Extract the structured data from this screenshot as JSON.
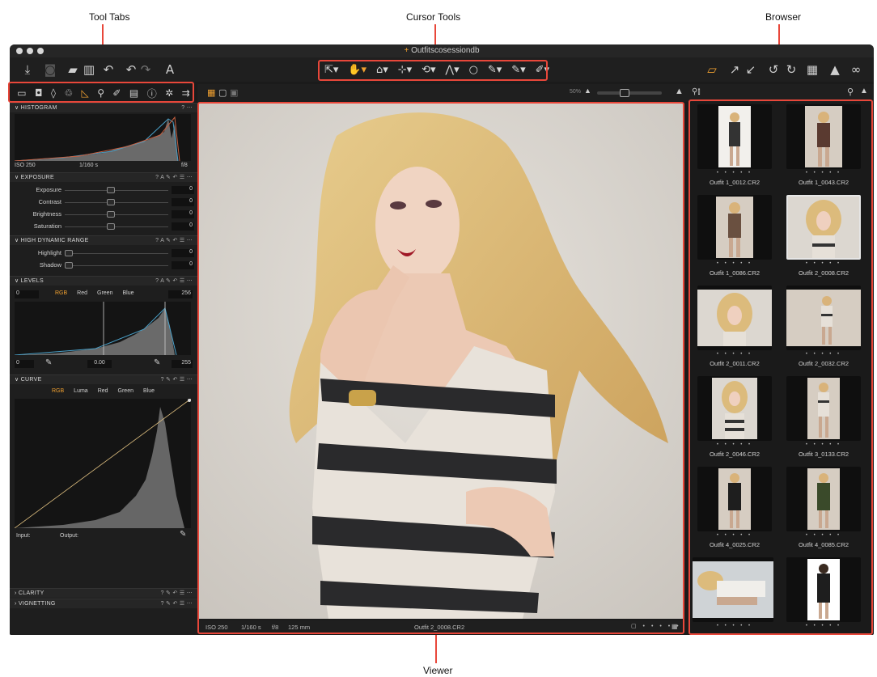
{
  "callouts": {
    "tool_tabs": "Tool Tabs",
    "cursor_tools": "Cursor Tools",
    "browser": "Browser",
    "viewer": "Viewer"
  },
  "window": {
    "title": "Outfitscosessiondb"
  },
  "cursor_tools": [
    "select-pointer-icon",
    "pan-hand-icon",
    "loupe-icon",
    "crop-icon",
    "rotate-icon",
    "keystone-icon",
    "spot-removal-icon",
    "color-picker-icon",
    "white-balance-picker-icon",
    "brush-icon"
  ],
  "left_panel": {
    "histogram": {
      "title": "HISTOGRAM",
      "iso": "ISO 250",
      "shutter": "1/160 s",
      "aperture": "f/8"
    },
    "exposure": {
      "title": "EXPOSURE",
      "rows": [
        {
          "label": "Exposure",
          "value": "0"
        },
        {
          "label": "Contrast",
          "value": "0"
        },
        {
          "label": "Brightness",
          "value": "0"
        },
        {
          "label": "Saturation",
          "value": "0"
        }
      ]
    },
    "hdr": {
      "title": "HIGH DYNAMIC RANGE",
      "rows": [
        {
          "label": "Highlight",
          "value": "0"
        },
        {
          "label": "Shadow",
          "value": "0"
        }
      ]
    },
    "levels": {
      "title": "LEVELS",
      "channels": [
        "RGB",
        "Red",
        "Green",
        "Blue"
      ],
      "left_val": "0",
      "right_val": "256",
      "bottom_left": "0",
      "bottom_mid": "0.00",
      "bottom_right": "255"
    },
    "curve": {
      "title": "CURVE",
      "channels": [
        "RGB",
        "Luma",
        "Red",
        "Green",
        "Blue"
      ],
      "input_label": "Input:",
      "output_label": "Output:"
    },
    "clarity": {
      "title": "CLARITY"
    },
    "vignetting": {
      "title": "VIGNETTING"
    }
  },
  "viewer": {
    "zoom": "50%",
    "status": {
      "iso": "ISO 250",
      "shutter": "1/160 s",
      "aperture": "f/8",
      "focal": "125 mm",
      "filename": "Outfit 2_0008.CR2"
    }
  },
  "browser": {
    "thumbs": [
      {
        "name": "Outfit 1_0012.CR2"
      },
      {
        "name": "Outfit 1_0043.CR2"
      },
      {
        "name": "Outfit 1_0086.CR2"
      },
      {
        "name": "Outfit 2_0008.CR2"
      },
      {
        "name": "Outfit 2_0011.CR2"
      },
      {
        "name": "Outfit 2_0032.CR2"
      },
      {
        "name": "Outfit 2_0046.CR2"
      },
      {
        "name": "Outfit 3_0133.CR2"
      },
      {
        "name": "Outfit 4_0025.CR2"
      },
      {
        "name": "Outfit 4_0085.CR2"
      },
      {
        "name": ""
      },
      {
        "name": ""
      }
    ],
    "selected_index": 3
  },
  "colors": {
    "accent": "#f0a030",
    "callout_red": "#e8473a"
  }
}
